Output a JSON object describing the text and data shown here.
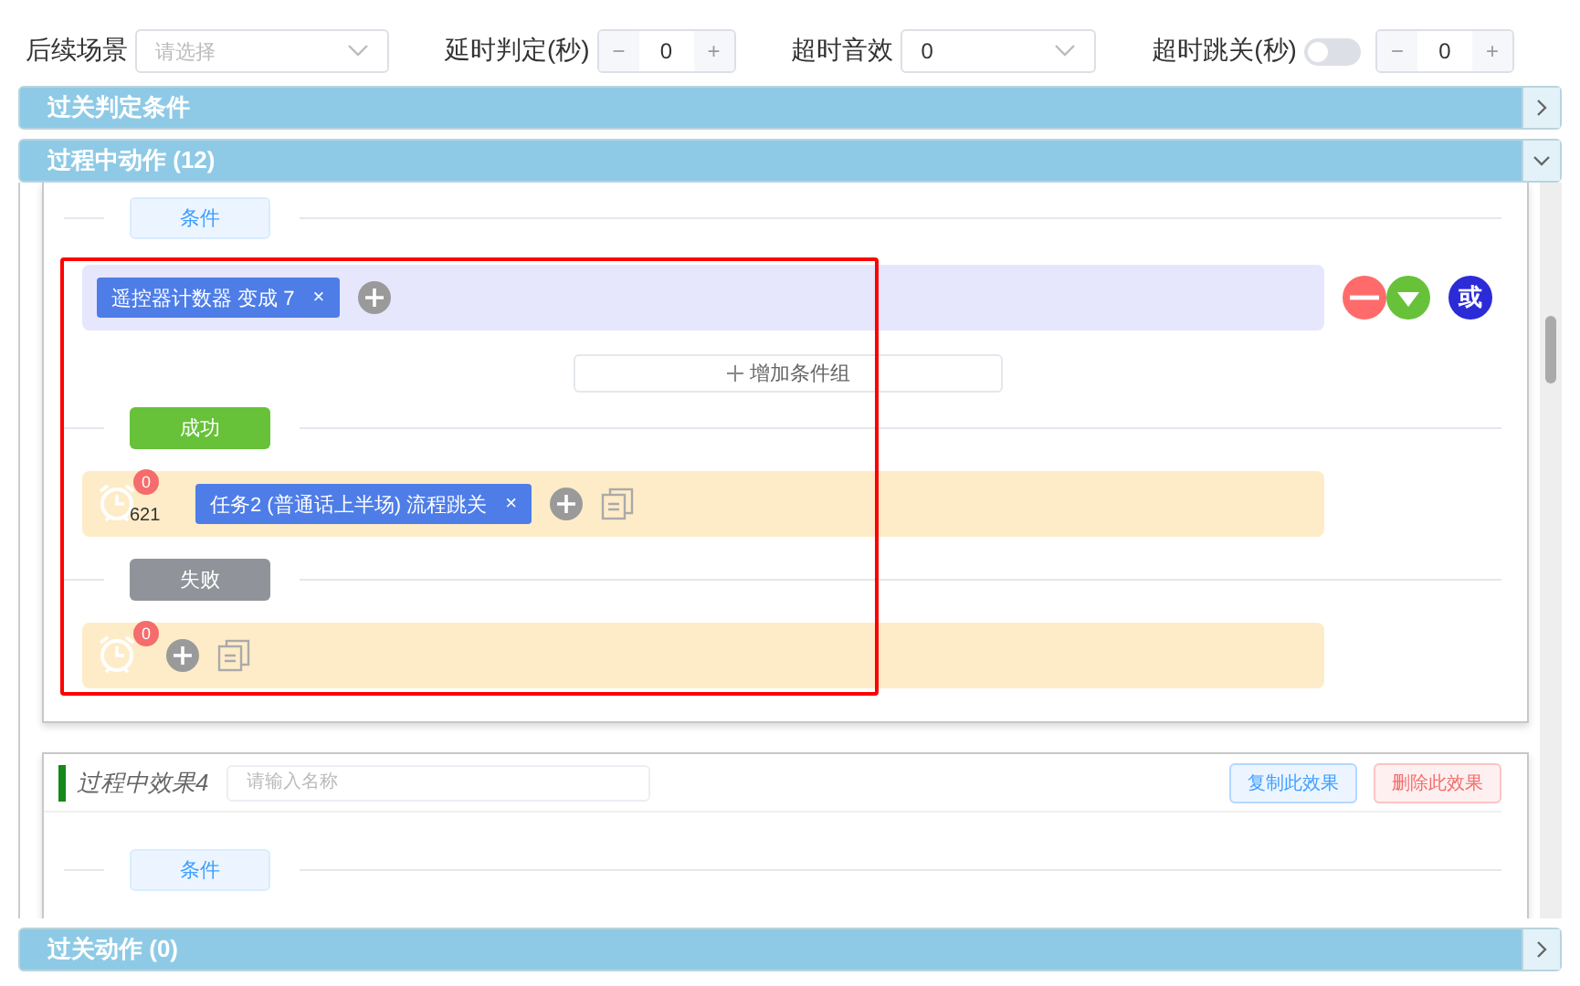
{
  "filters": [
    {
      "kind": "select",
      "label": "后续场景",
      "placeholder": "请选择"
    },
    {
      "kind": "stepper",
      "label": "延时判定(秒)",
      "value": "0",
      "minus": "−",
      "plus": "+"
    },
    {
      "kind": "select",
      "label": "超时音效",
      "value": "0"
    },
    {
      "kind": "switch_stepper",
      "label": "超时跳关(秒)",
      "on": false,
      "value": "0",
      "minus": "−",
      "plus": "+"
    }
  ],
  "sections": [
    {
      "title": "过关判定条件",
      "expanded": false
    },
    {
      "title": "过程中动作 (12)",
      "expanded": true
    },
    {
      "title": "过关动作 (0)",
      "expanded": false
    }
  ],
  "effects": [
    {
      "condition_label": "条件",
      "condition_groups": [
        {
          "tags": [
            {
              "text": "遥控器计数器 变成 7",
              "close": "×"
            }
          ],
          "logic": "或"
        }
      ],
      "add_group": "增加条件组",
      "branches": [
        {
          "kind": "success",
          "label": "成功",
          "badge": "0",
          "delay": "621",
          "tags": [
            {
              "text": "任务2 (普通话上半场) 流程跳关",
              "close": "×"
            }
          ]
        },
        {
          "kind": "fail",
          "label": "失败",
          "badge": "0"
        }
      ]
    },
    {
      "title": "过程中效果4",
      "name_placeholder": "请输入名称",
      "buttons": [
        {
          "kind": "copy",
          "label": "复制此效果"
        },
        {
          "kind": "delete",
          "label": "删除此效果"
        }
      ],
      "condition_label": "条件"
    }
  ]
}
